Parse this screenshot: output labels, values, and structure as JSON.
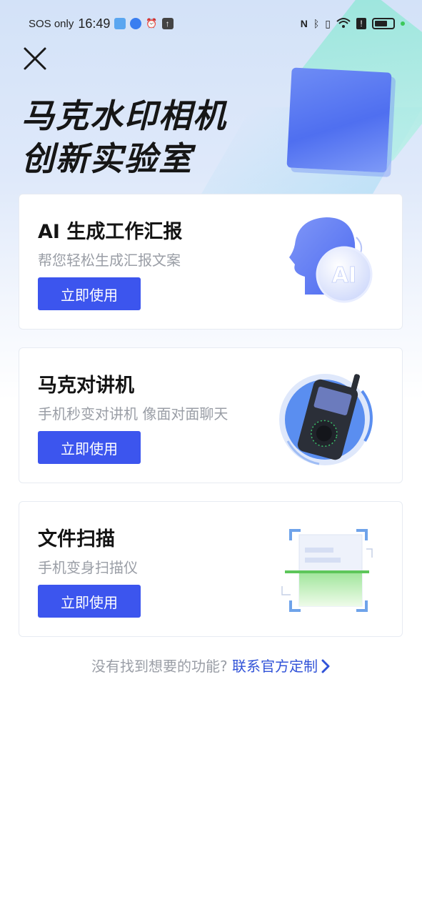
{
  "status_bar": {
    "carrier": "SOS only",
    "time": "16:49",
    "battery_icon": "battery-icon",
    "signal_icons": [
      "nfc-icon",
      "bluetooth-icon",
      "vibrate-icon",
      "wifi-icon",
      "alert-icon"
    ]
  },
  "header": {
    "title_line1": "马克水印相机",
    "title_line2": "创新实验室",
    "close_icon": "close-icon"
  },
  "cards": [
    {
      "title": "AI 生成工作汇报",
      "subtitle": "帮您轻松生成汇报文案",
      "button_label": "立即使用",
      "illustration": "ai-head-icon"
    },
    {
      "title": "马克对讲机",
      "subtitle": "手机秒变对讲机 像面对面聊天",
      "button_label": "立即使用",
      "illustration": "walkie-talkie-icon"
    },
    {
      "title": "文件扫描",
      "subtitle": "手机变身扫描仪",
      "button_label": "立即使用",
      "illustration": "document-scan-icon"
    }
  ],
  "footer": {
    "question": "没有找到想要的功能?",
    "link_label": "联系官方定制"
  },
  "colors": {
    "primary": "#3c55ee",
    "link": "#3153d8",
    "muted_text": "#9a9ea6"
  }
}
